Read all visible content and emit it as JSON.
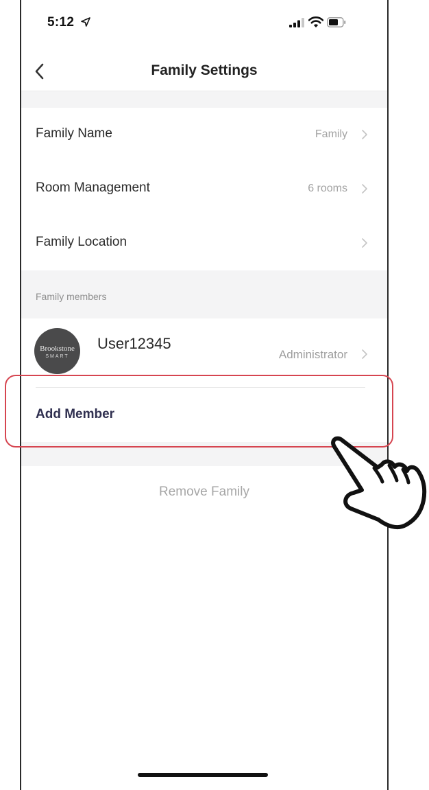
{
  "status_bar": {
    "time": "5:12"
  },
  "nav": {
    "title": "Family Settings"
  },
  "settings": {
    "family_name": {
      "label": "Family Name",
      "value": "Family"
    },
    "room_management": {
      "label": "Room Management",
      "value": "6 rooms"
    },
    "family_location": {
      "label": "Family Location",
      "value": ""
    }
  },
  "members": {
    "section_title": "Family members",
    "user": {
      "name": "User12345",
      "role": "Administrator",
      "avatar_text_line1": "Brookstone",
      "avatar_text_line2": "SMART"
    },
    "add_label": "Add Member"
  },
  "actions": {
    "remove_label": "Remove Family"
  },
  "colors": {
    "highlight": "#d64550",
    "accent_text": "#303050",
    "secondary_text": "#a2a2a2",
    "background": "#f4f4f5"
  },
  "icons": {
    "back": "chevron-left-icon",
    "row_arrow": "chevron-right-icon",
    "pointer": "hand-pointer-icon"
  }
}
